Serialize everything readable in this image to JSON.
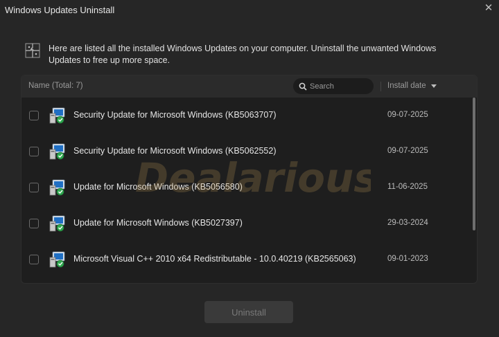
{
  "window": {
    "title": "Windows Updates Uninstall",
    "close_glyph": "✕"
  },
  "intro": {
    "icon": "puzzle-icon",
    "text": "Here are listed all the installed Windows Updates on your computer. Uninstall the unwanted Windows Updates to free up more space."
  },
  "list": {
    "name_header": "Name (Total: 7)",
    "search_placeholder": "Search",
    "date_header": "Install date",
    "rows": [
      {
        "name": "Security Update for Microsoft Windows (KB5063707)",
        "date": "09-07-2025",
        "checked": false
      },
      {
        "name": "Security Update for Microsoft Windows (KB5062552)",
        "date": "09-07-2025",
        "checked": false
      },
      {
        "name": "Update for Microsoft Windows (KB5056580)",
        "date": "11-06-2025",
        "checked": false
      },
      {
        "name": "Update for Microsoft Windows (KB5027397)",
        "date": "29-03-2024",
        "checked": false
      },
      {
        "name": "Microsoft Visual C++ 2010  x64 Redistributable - 10.0.40219 (KB2565063)",
        "date": "09-01-2023",
        "checked": false
      }
    ]
  },
  "actions": {
    "uninstall_label": "Uninstall",
    "uninstall_enabled": false
  },
  "watermark": {
    "text": "Dealarious"
  },
  "colors": {
    "background": "#262626",
    "panel": "#1e1e1e",
    "header": "#2b2b2b",
    "text": "#e6e6e6",
    "muted": "#9a9a9a"
  }
}
